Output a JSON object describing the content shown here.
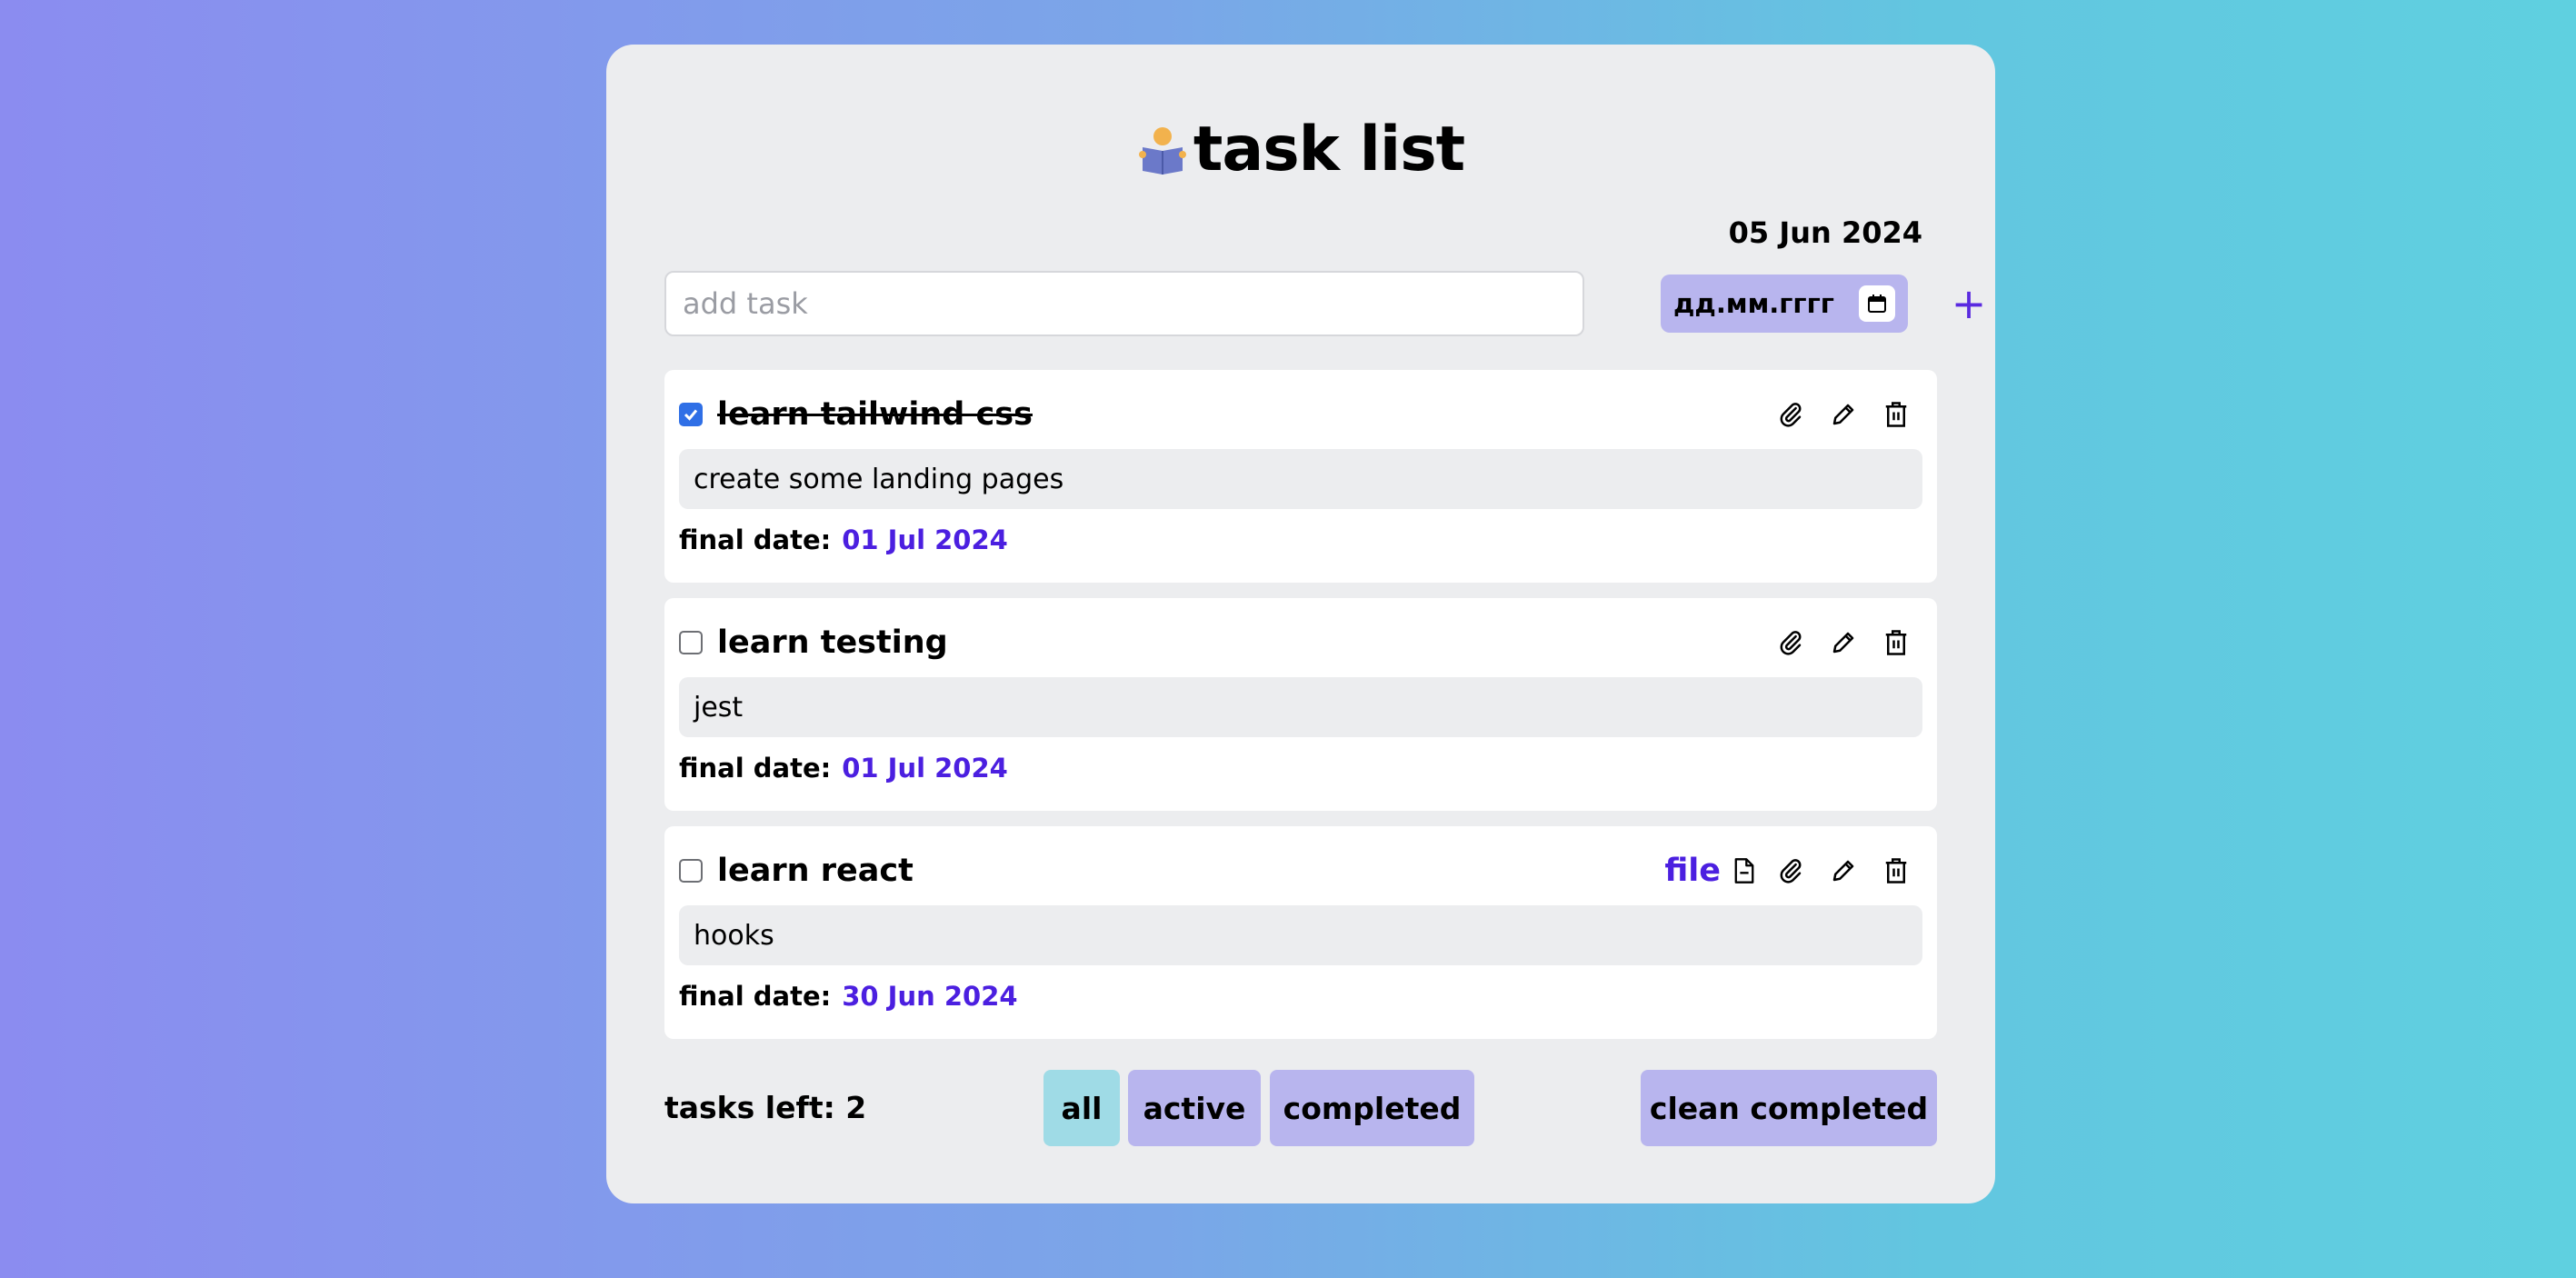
{
  "app": {
    "title": "task list"
  },
  "today": "05 Jun 2024",
  "add_form": {
    "placeholder": "add task",
    "date_placeholder": "дд.мм.гггг",
    "add_symbol": "+"
  },
  "tasks": [
    {
      "title": "learn tailwind css",
      "completed": true,
      "description": "create some landing pages",
      "final_date_label": "final date:",
      "final_date": "01 Jul 2024",
      "file_label": ""
    },
    {
      "title": "learn testing",
      "completed": false,
      "description": "jest",
      "final_date_label": "final date:",
      "final_date": "01 Jul 2024",
      "file_label": ""
    },
    {
      "title": "learn react",
      "completed": false,
      "description": "hooks",
      "final_date_label": "final date:",
      "final_date": "30 Jun 2024",
      "file_label": "file"
    }
  ],
  "footer": {
    "tasks_left": "tasks left: 2",
    "filters": [
      "all",
      "active",
      "completed"
    ],
    "selected_filter": "all",
    "clean_label": "clean completed"
  },
  "colors": {
    "accent": "#4b1fe0",
    "button": "#b8b5ee",
    "selected_button": "#9fdbe6",
    "checkbox": "#2f6fe6"
  }
}
